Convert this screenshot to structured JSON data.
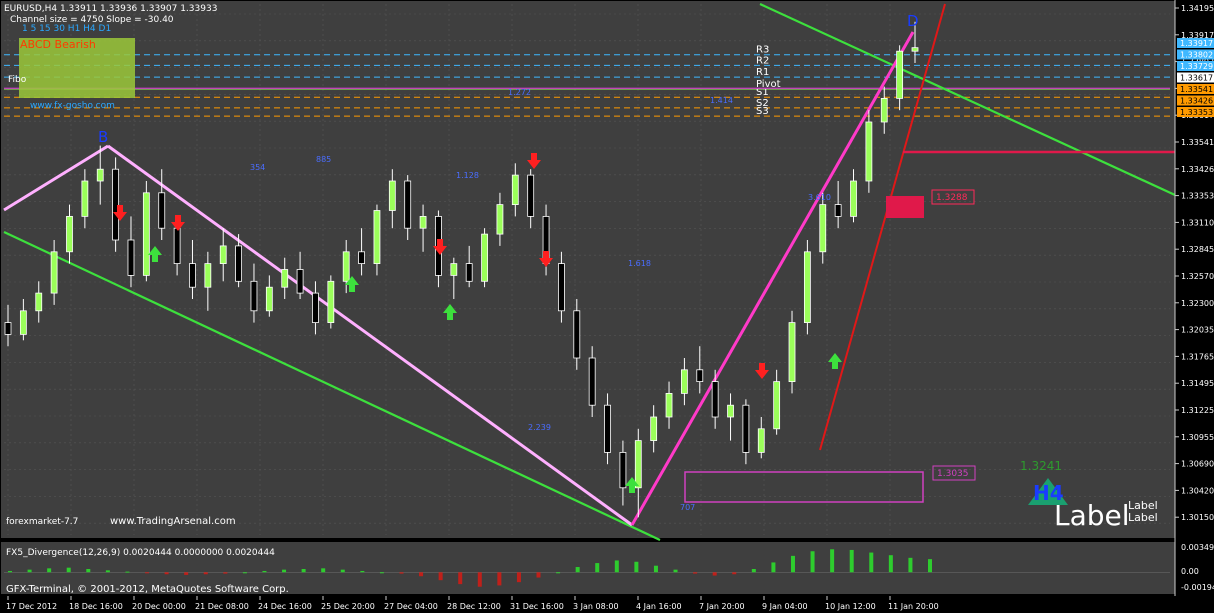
{
  "header": {
    "symbol_line": "EURUSD,H4  1.33911 1.33936 1.33907 1.33933",
    "channel_line": "Channel size = 4750 Slope = -30.40"
  },
  "panel": {
    "title": "ABCD Bearish",
    "timeframes": "1  5  15 30  H1 H4 D1",
    "fibo_label": "Fibo",
    "url": "www.fx-gosho.com"
  },
  "levels": [
    {
      "name": "R3",
      "price": 1.3387
    },
    {
      "name": "R2",
      "price": 1.3378
    },
    {
      "name": "R1",
      "price": 1.3368
    },
    {
      "name": "Pivot",
      "price": 1.3358
    },
    {
      "name": "S1",
      "price": 1.3351
    },
    {
      "name": "S2",
      "price": 1.3342
    },
    {
      "name": "S3",
      "price": 1.3335
    }
  ],
  "price_tags": [
    {
      "value": "1.33917",
      "color": "#3fb8ff",
      "text": "#ffffff",
      "price": 1.33917
    },
    {
      "value": "1.33802",
      "color": "#3fb8ff",
      "text": "#ffffff",
      "price": 1.338
    },
    {
      "value": "1.33729",
      "color": "#3fb8ff",
      "text": "#ffffff",
      "price": 1.33729
    },
    {
      "value": "1.33617",
      "color": "#ffffff",
      "text": "#000000",
      "price": 1.33617
    },
    {
      "value": "1.33541",
      "color": "#ff9a00",
      "text": "#000000",
      "price": 1.33541
    },
    {
      "value": "1.33426",
      "color": "#ff9a00",
      "text": "#000000",
      "price": 1.33426
    },
    {
      "value": "1.33353",
      "color": "#ff9a00",
      "text": "#000000",
      "price": 1.33353
    }
  ],
  "chart_data": {
    "type": "candlestick",
    "title": "EURUSD,H4",
    "ylim": [
      1.298,
      1.343
    ],
    "y_ticks": [
      "1.34195",
      "1.33917",
      "1.33802",
      "1.33729",
      "1.33617",
      "1.33541",
      "1.33426",
      "1.33353",
      "1.33110",
      "1.32845",
      "1.32570",
      "1.32300",
      "1.32035",
      "1.31765",
      "1.31495",
      "1.31225",
      "1.30955",
      "1.30690",
      "1.30420",
      "1.30150"
    ],
    "x_ticks": [
      "17 Dec 2012",
      "18 Dec 16:00",
      "20 Dec 00:00",
      "21 Dec 08:00",
      "24 Dec 16:00",
      "25 Dec 20:00",
      "27 Dec 04:00",
      "28 Dec 12:00",
      "31 Dec 16:00",
      "3 Jan 08:00",
      "4 Jan 16:00",
      "7 Jan 20:00",
      "9 Jan 04:00",
      "10 Jan 12:00",
      "11 Jan 20:00"
    ],
    "pattern_points": [
      {
        "label": "B",
        "price": 1.3308
      },
      {
        "label": "D",
        "price": 1.3415
      }
    ],
    "annotations": [
      "1.3288",
      "1.3035",
      "707",
      "2.239",
      "3.610",
      "1.128",
      "885",
      "354",
      "1.272",
      "1.414",
      "1.618"
    ],
    "pattern_boxes": [
      {
        "label": "1.3288",
        "color": "#ff2a5a"
      },
      {
        "label": "1.3035",
        "color": "#d040c0"
      }
    ],
    "candles": [
      [
        1.316,
        1.3175,
        1.314,
        1.315
      ],
      [
        1.315,
        1.318,
        1.3145,
        1.317
      ],
      [
        1.317,
        1.3195,
        1.316,
        1.3185
      ],
      [
        1.3185,
        1.323,
        1.3175,
        1.322
      ],
      [
        1.322,
        1.326,
        1.321,
        1.325
      ],
      [
        1.325,
        1.329,
        1.324,
        1.328
      ],
      [
        1.328,
        1.331,
        1.326,
        1.329
      ],
      [
        1.329,
        1.33,
        1.322,
        1.323
      ],
      [
        1.323,
        1.325,
        1.319,
        1.32
      ],
      [
        1.32,
        1.328,
        1.3195,
        1.327
      ],
      [
        1.327,
        1.329,
        1.323,
        1.324
      ],
      [
        1.324,
        1.325,
        1.32,
        1.321
      ],
      [
        1.321,
        1.323,
        1.318,
        1.319
      ],
      [
        1.319,
        1.322,
        1.317,
        1.321
      ],
      [
        1.321,
        1.324,
        1.3195,
        1.3225
      ],
      [
        1.3225,
        1.3235,
        1.319,
        1.3195
      ],
      [
        1.3195,
        1.321,
        1.316,
        1.317
      ],
      [
        1.317,
        1.32,
        1.3165,
        1.319
      ],
      [
        1.319,
        1.3215,
        1.318,
        1.3205
      ],
      [
        1.3205,
        1.322,
        1.318,
        1.3185
      ],
      [
        1.3185,
        1.3195,
        1.315,
        1.316
      ],
      [
        1.316,
        1.32,
        1.3155,
        1.3195
      ],
      [
        1.3195,
        1.323,
        1.3185,
        1.322
      ],
      [
        1.322,
        1.324,
        1.32,
        1.321
      ],
      [
        1.321,
        1.326,
        1.32,
        1.3255
      ],
      [
        1.3255,
        1.329,
        1.324,
        1.328
      ],
      [
        1.328,
        1.3285,
        1.323,
        1.324
      ],
      [
        1.324,
        1.326,
        1.322,
        1.325
      ],
      [
        1.325,
        1.3255,
        1.319,
        1.32
      ],
      [
        1.32,
        1.3215,
        1.318,
        1.321
      ],
      [
        1.321,
        1.3225,
        1.319,
        1.3195
      ],
      [
        1.3195,
        1.324,
        1.319,
        1.3235
      ],
      [
        1.3235,
        1.327,
        1.3225,
        1.326
      ],
      [
        1.326,
        1.3295,
        1.325,
        1.3285
      ],
      [
        1.3285,
        1.329,
        1.324,
        1.325
      ],
      [
        1.325,
        1.326,
        1.32,
        1.321
      ],
      [
        1.321,
        1.322,
        1.316,
        1.317
      ],
      [
        1.317,
        1.318,
        1.312,
        1.313
      ],
      [
        1.313,
        1.314,
        1.308,
        1.309
      ],
      [
        1.309,
        1.31,
        1.304,
        1.305
      ],
      [
        1.305,
        1.306,
        1.3005,
        1.302
      ],
      [
        1.302,
        1.307,
        1.2995,
        1.306
      ],
      [
        1.306,
        1.309,
        1.305,
        1.308
      ],
      [
        1.308,
        1.311,
        1.307,
        1.31
      ],
      [
        1.31,
        1.313,
        1.309,
        1.312
      ],
      [
        1.312,
        1.314,
        1.31,
        1.311
      ],
      [
        1.311,
        1.312,
        1.307,
        1.308
      ],
      [
        1.308,
        1.31,
        1.306,
        1.309
      ],
      [
        1.309,
        1.3095,
        1.304,
        1.305
      ],
      [
        1.305,
        1.308,
        1.3045,
        1.307
      ],
      [
        1.307,
        1.312,
        1.3065,
        1.311
      ],
      [
        1.311,
        1.317,
        1.31,
        1.316
      ],
      [
        1.316,
        1.323,
        1.315,
        1.322
      ],
      [
        1.322,
        1.327,
        1.321,
        1.326
      ],
      [
        1.326,
        1.328,
        1.324,
        1.325
      ],
      [
        1.325,
        1.329,
        1.3245,
        1.328
      ],
      [
        1.328,
        1.334,
        1.327,
        1.333
      ],
      [
        1.333,
        1.336,
        1.332,
        1.335
      ],
      [
        1.335,
        1.3395,
        1.334,
        1.339
      ],
      [
        1.339,
        1.3415,
        1.338,
        1.3393
      ]
    ],
    "indicator": {
      "name": "FX5_Divergence(12,26,9) 0.0020444 0.0000000 0.0020444",
      "ylim": [
        -0.003,
        0.004
      ],
      "y_ticks": [
        "0.00349",
        "0.00",
        "-0.00194"
      ],
      "histogram": [
        0.0002,
        0.0004,
        0.0006,
        0.0007,
        0.0005,
        0.0003,
        0.0001,
        -0.0001,
        -0.0003,
        -0.0004,
        -0.0003,
        -0.0002,
        0.0,
        0.0002,
        0.0004,
        0.0005,
        0.0006,
        0.0004,
        0.0002,
        0.0,
        -0.0002,
        -0.0006,
        -0.0012,
        -0.0018,
        -0.0022,
        -0.002,
        -0.0015,
        -0.0008,
        0.0,
        0.0008,
        0.0014,
        0.0018,
        0.0016,
        0.001,
        0.0004,
        -0.0002,
        -0.0005,
        -0.0003,
        0.0005,
        0.0015,
        0.0025,
        0.0032,
        0.0035,
        0.0034,
        0.003,
        0.0026,
        0.0022,
        0.002
      ]
    }
  },
  "footer": {
    "copyright": "GFX-Terminal, © 2001-2012, MetaQuotes Software Corp.",
    "watermark": "www.TradingArsenal.com",
    "brand_prefix": "forexmarket-7.7",
    "tf_label": "H4",
    "label_big": "Label",
    "label_small_1": "Label",
    "label_small_2": "Label",
    "box_value": "1.3241"
  }
}
